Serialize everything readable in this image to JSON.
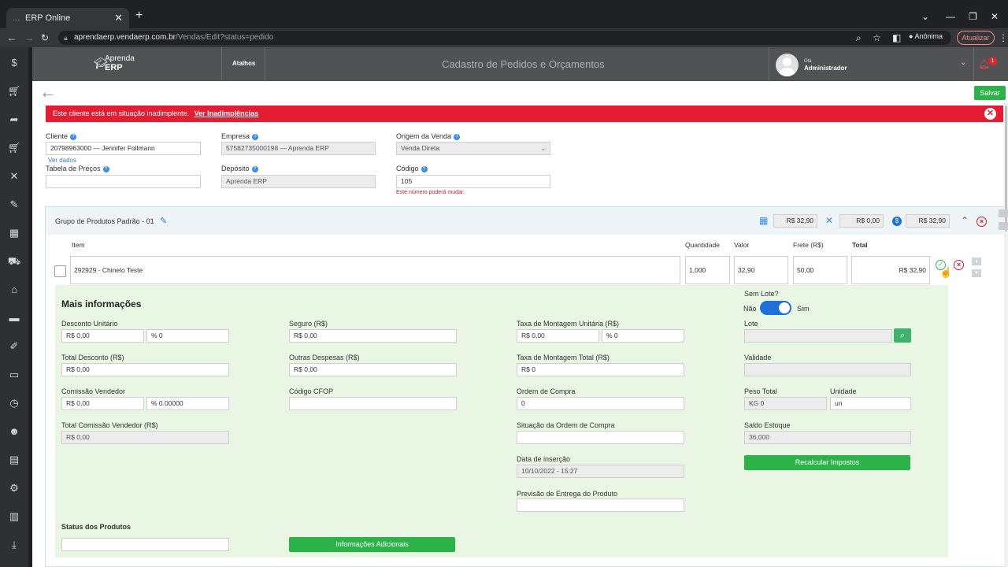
{
  "browser": {
    "tab_title": "ERP Online",
    "tab_dots": "...",
    "tab_close": "✕",
    "new_tab": "+",
    "url_host": "aprendaerp.vendaerp.com.br",
    "url_path": "/Vendas/Edit?status=pedido",
    "incognito_label": "Anônima",
    "update_label": "Atualizar"
  },
  "header": {
    "logo_line1": "Aprenda",
    "logo_line2": "ERP",
    "shortcuts_label": "Atalhos",
    "page_title": "Cadastro de Pedidos e Orçamentos",
    "greeting": "Olá",
    "user_name": "Administrador",
    "notification_count": "1"
  },
  "toolbar": {
    "save_label": "Salvar"
  },
  "alert": {
    "message": "Este cliente está em situação inadimplente.",
    "link_label": "Ver Inadimplências"
  },
  "form": {
    "cliente_label": "Cliente",
    "cliente_value": "20798963000 — Jennifer Follmann",
    "ver_dados": "Ver dados",
    "empresa_label": "Empresa",
    "empresa_value": "57582735000198 — Aprenda ERP",
    "origem_label": "Origem da Venda",
    "origem_value": "Venda Direta",
    "tabela_label": "Tabela de Preços",
    "tabela_value": "",
    "deposito_label": "Depósito",
    "deposito_value": "Aprenda ERP",
    "codigo_label": "Código",
    "codigo_value": "105",
    "codigo_warning": "Este número poderá mudar."
  },
  "group": {
    "title": "Grupo de Produtos Padrão - 01",
    "sum_products": "R$ 32,90",
    "sum_services": "R$ 0,00",
    "sum_total": "R$ 32,90",
    "columns": {
      "item": "Item",
      "quantidade": "Quantidade",
      "valor": "Valor",
      "frete": "Frete (R$)",
      "total": "Total"
    },
    "row": {
      "item": "292929 - Chinelo Teste",
      "quantidade": "1,000",
      "valor": "32,90",
      "frete": "50,00",
      "total": "R$ 32,90"
    }
  },
  "more": {
    "title": "Mais informações",
    "desconto_unitario_label": "Desconto Unitário",
    "desconto_unitario_rs": "R$ 0,00",
    "desconto_unitario_pct": "% 0",
    "total_desconto_label": "Total Desconto (R$)",
    "total_desconto_value": "R$ 0,00",
    "comissao_label": "Comissão Vendedor",
    "comissao_rs": "R$ 0,00",
    "comissao_pct": "% 0.00000",
    "total_comissao_label": "Total Comissão Vendedor (R$)",
    "total_comissao_value": "R$ 0,00",
    "status_label": "Status dos Produtos",
    "status_value": "",
    "seguro_label": "Seguro (R$)",
    "seguro_value": "R$ 0,00",
    "outras_label": "Outras Despesas (R$)",
    "outras_value": "R$ 0,00",
    "cfop_label": "Código CFOP",
    "cfop_value": "",
    "info_adicionais_label": "Informações Adicionais",
    "montagem_unit_label": "Taxa de Montagem Unitária (R$)",
    "montagem_unit_rs": "R$ 0,00",
    "montagem_unit_pct": "% 0",
    "montagem_total_label": "Taxa de Montagem Total (R$)",
    "montagem_total_value": "R$ 0",
    "ordem_compra_label": "Ordem de Compra",
    "ordem_compra_value": "0",
    "situacao_label": "Situação da Ordem de Compra",
    "situacao_value": "",
    "data_insercao_label": "Data de inserção",
    "data_insercao_value": "10/10/2022 - 15:27",
    "previsao_label": "Previsão de Entrega do Produto",
    "previsao_value": "",
    "sem_lote_label": "Sem Lote?",
    "nao_label": "Não",
    "sim_label": "Sim",
    "sem_lote_on": true,
    "lote_label": "Lote",
    "lote_value": "",
    "validade_label": "Validade",
    "validade_value": "",
    "peso_label": "Peso Total",
    "peso_value": "KG 0",
    "unidade_label": "Unidade",
    "unidade_value": "un",
    "saldo_label": "Saldo Estoque",
    "saldo_value": "36,000",
    "recalc_label": "Recalcular Impostos"
  }
}
